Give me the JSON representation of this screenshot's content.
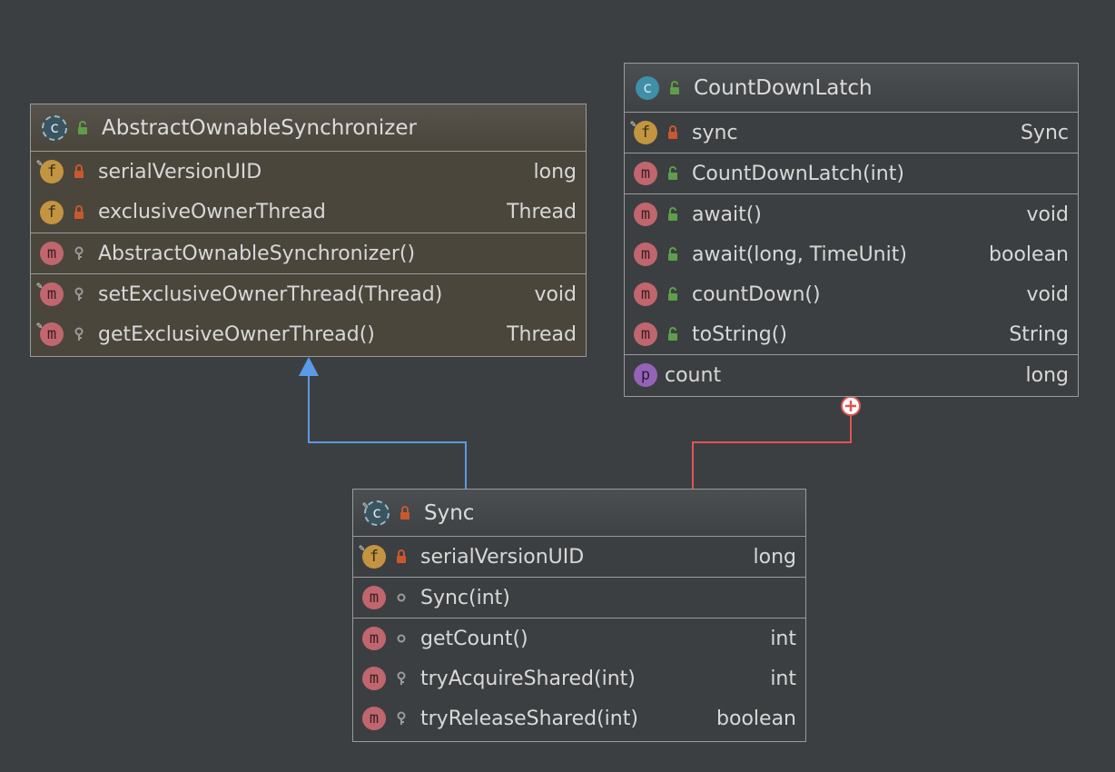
{
  "classes": {
    "aos": {
      "name": "AbstractOwnableSynchronizer",
      "fields": [
        {
          "name": "serialVersionUID",
          "type": "long"
        },
        {
          "name": "exclusiveOwnerThread",
          "type": "Thread"
        }
      ],
      "constructors": [
        {
          "name": "AbstractOwnableSynchronizer()",
          "type": ""
        }
      ],
      "methods": [
        {
          "name": "setExclusiveOwnerThread(Thread)",
          "type": "void"
        },
        {
          "name": "getExclusiveOwnerThread()",
          "type": "Thread"
        }
      ]
    },
    "cdl": {
      "name": "CountDownLatch",
      "fields": [
        {
          "name": "sync",
          "type": "Sync"
        }
      ],
      "constructors": [
        {
          "name": "CountDownLatch(int)",
          "type": ""
        }
      ],
      "methods": [
        {
          "name": "await()",
          "type": "void"
        },
        {
          "name": "await(long, TimeUnit)",
          "type": "boolean"
        },
        {
          "name": "countDown()",
          "type": "void"
        },
        {
          "name": "toString()",
          "type": "String"
        }
      ],
      "properties": [
        {
          "name": "count",
          "type": "long"
        }
      ]
    },
    "sync": {
      "name": "Sync",
      "fields": [
        {
          "name": "serialVersionUID",
          "type": "long"
        }
      ],
      "constructors": [
        {
          "name": "Sync(int)",
          "type": ""
        }
      ],
      "methods": [
        {
          "name": "getCount()",
          "type": "int"
        },
        {
          "name": "tryAcquireShared(int)",
          "type": "int"
        },
        {
          "name": "tryReleaseShared(int)",
          "type": "boolean"
        }
      ]
    }
  },
  "icons": {
    "class": "c",
    "field": "f",
    "method": "m",
    "property": "p"
  },
  "colors": {
    "background": "#3c3f41",
    "inheritance_edge": "#5a9ae6",
    "inner_class_edge": "#e05555"
  }
}
